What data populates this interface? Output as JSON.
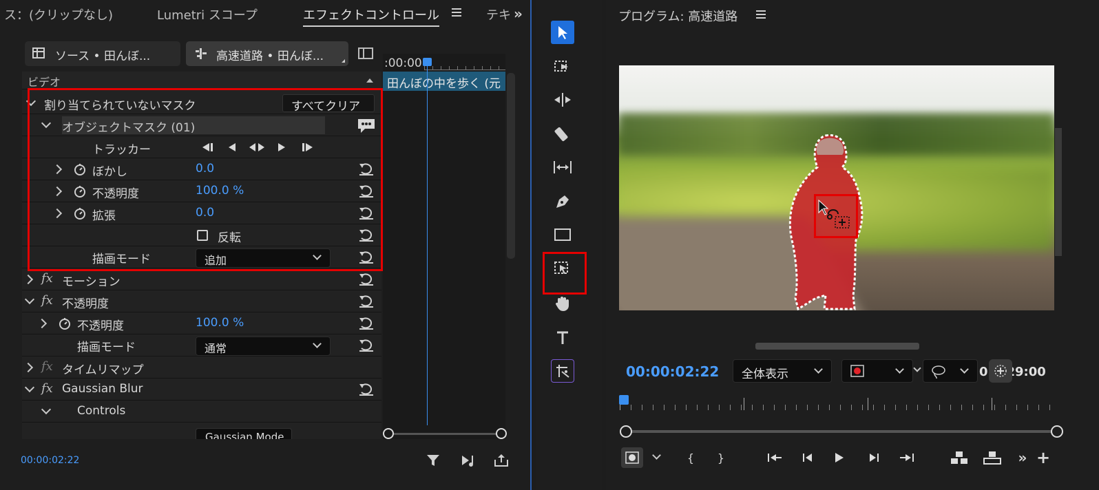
{
  "left_panel": {
    "tabs": [
      {
        "label": "ス：(クリップなし)"
      },
      {
        "label": "Lumetri スコープ"
      },
      {
        "label": "エフェクトコントロール"
      },
      {
        "label": "テキ"
      }
    ],
    "source_label": "ソース • 田んぼ...",
    "sequence_label": "高速道路 • 田んぼ...",
    "timeline_time": ":00:00",
    "clip_name": "田んぼの中を歩く (元",
    "section_video": "ビデオ",
    "rows": {
      "unassigned_mask": "割り当てられていないマスク",
      "clear_all": "すべてクリア",
      "object_mask": "オブジェクトマスク (01)",
      "tracker": "トラッカー",
      "blur": "ぼかし",
      "blur_value": "0.0",
      "opacity": "不透明度",
      "opacity_value": "100.0 %",
      "expand": "拡張",
      "expand_value": "0.0",
      "invert": "反転",
      "blend_mode": "描画モード",
      "blend_value": "追加",
      "motion": "モーション",
      "opacity_effect": "不透明度",
      "opacity2": "不透明度",
      "opacity2_value": "100.0 %",
      "blend_mode2": "描画モード",
      "blend_value2": "通常",
      "time_remap": "タイムリマップ",
      "gaussian_blur": "Gaussian Blur",
      "controls": "Controls",
      "cut_item": "Gaussian Mode"
    },
    "footer_time": "00:00:02:22"
  },
  "program_monitor": {
    "title": "プログラム: 高速道路",
    "current_time": "00:00:02:22",
    "zoom": "全体表示",
    "duration": "0:3:29:00"
  },
  "colors": {
    "accent_blue": "#2d8ceb",
    "highlight_red": "#e50000",
    "mask_red": "#c8262c"
  }
}
